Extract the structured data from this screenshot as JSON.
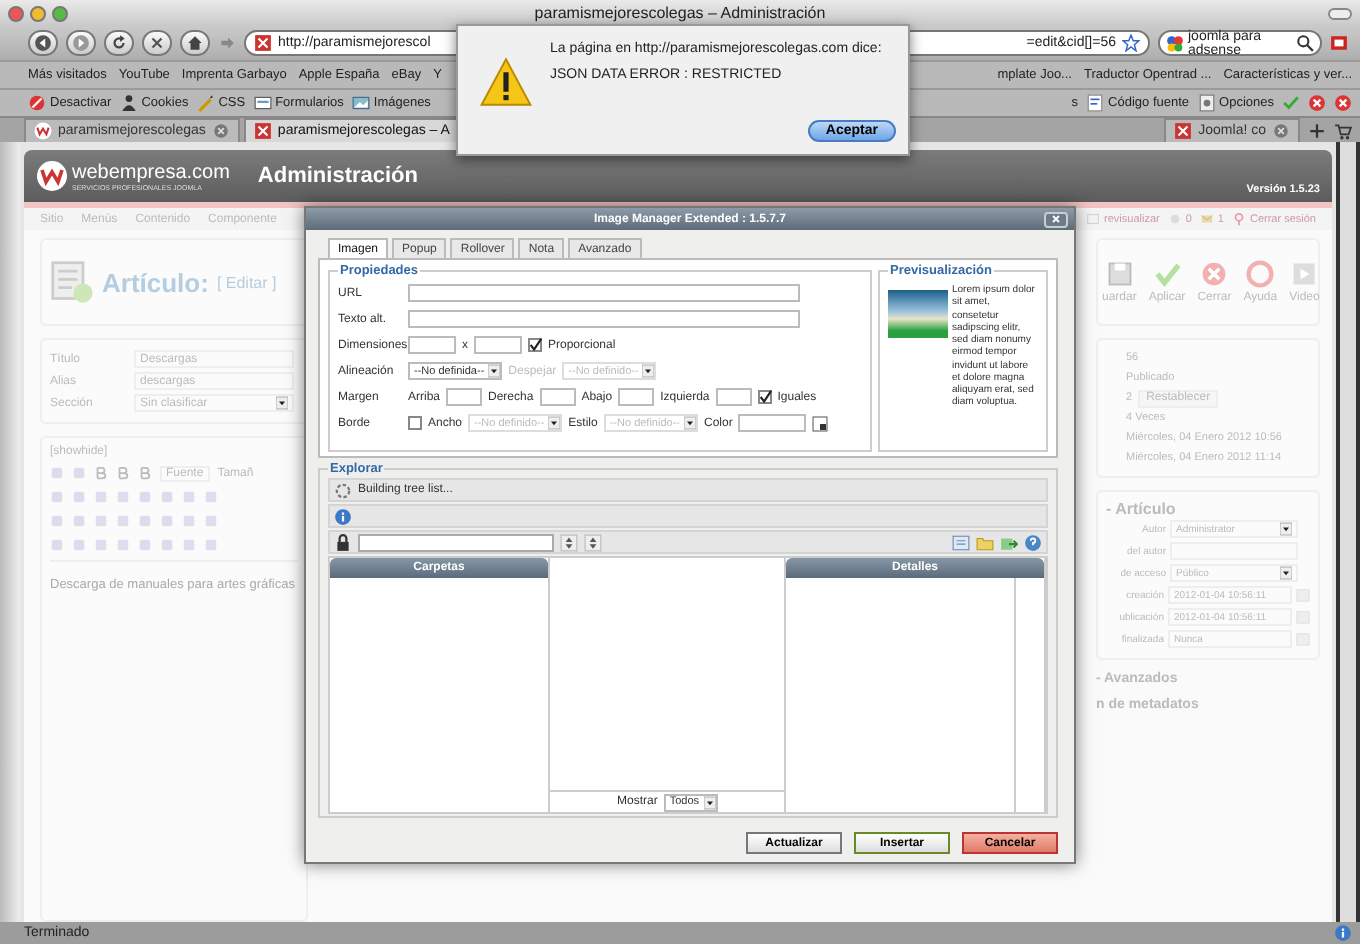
{
  "window": {
    "title": "paramismejorescolegas – Administración"
  },
  "navigation": {
    "url_start": "http://paramismejorescol",
    "url_end": "=edit&cid[]=56",
    "search_value": "joomla para adsense"
  },
  "bookmarks_left": [
    "Más visitados",
    "YouTube",
    "Imprenta Garbayo",
    "Apple España",
    "eBay",
    "Y"
  ],
  "bookmarks_right": [
    "mplate Joo...",
    "Traductor Opentrad ...",
    "Características y ver..."
  ],
  "toolbar_left": [
    {
      "label": "Desactivar",
      "kind": "disable"
    },
    {
      "label": "Cookies",
      "kind": "cookies"
    },
    {
      "label": "CSS",
      "kind": "css"
    },
    {
      "label": "Formularios",
      "kind": "forms"
    },
    {
      "label": "Imágenes",
      "kind": "images"
    }
  ],
  "toolbar_right": [
    {
      "label": "s",
      "kind": "none"
    },
    {
      "label": "Código fuente",
      "kind": "source"
    },
    {
      "label": "Opciones",
      "kind": "options"
    }
  ],
  "tabs": [
    {
      "label": "paramismejorescolegas",
      "selected": false
    },
    {
      "label": "paramismejorescolegas – A",
      "selected": true
    },
    {
      "label": "Joomla! co",
      "selected": false
    }
  ],
  "alert": {
    "message": "La página en http://paramismejorescolegas.com dice:",
    "error": "JSON DATA ERROR : RESTRICTED",
    "button": "Aceptar"
  },
  "site": {
    "logo": "webempresa.com",
    "tagline": "SERVICIOS PROFESIONALES JOOMLA",
    "heading": "Administración",
    "version": "Versión 1.5.23"
  },
  "menu": [
    "Sitio",
    "Menús",
    "Contenido",
    "Componente"
  ],
  "header_links": [
    {
      "label": "revisualizar",
      "kind": "preview"
    },
    {
      "label": "0",
      "kind": "messages"
    },
    {
      "label": "1",
      "kind": "users"
    },
    {
      "label": "Cerrar sesión",
      "kind": "logout"
    }
  ],
  "article": {
    "title": "Artículo:",
    "action": "[ Editar ]"
  },
  "actions": [
    {
      "label": "uardar",
      "kind": "save"
    },
    {
      "label": "Aplicar",
      "kind": "apply"
    },
    {
      "label": "Cerrar",
      "kind": "close"
    },
    {
      "label": "Ayuda",
      "kind": "help"
    },
    {
      "label": "Video",
      "kind": "video"
    }
  ],
  "fields": [
    {
      "label": "Título",
      "value": "Descargas",
      "kind": "text"
    },
    {
      "label": "Alias",
      "value": "descargas",
      "kind": "text"
    },
    {
      "label": "Sección",
      "value": "Sin clasificar",
      "kind": "select"
    }
  ],
  "editor": {
    "tag": "[showhide]",
    "font": "Fuente",
    "size": "Tamañ",
    "content": "Descarga de manuales para artes gráficas"
  },
  "details": [
    {
      "value": "56"
    },
    {
      "value": "Publicado"
    },
    {
      "value": "2",
      "button": "Restablecer"
    },
    {
      "value": "4 Veces"
    },
    {
      "value": "Miércoles, 04 Enero 2012 10:56"
    },
    {
      "value": "Miércoles, 04 Enero 2012 11:14"
    }
  ],
  "parameters": {
    "title": "- Artículo",
    "rows": [
      {
        "label": "Autor",
        "value": "Administrator",
        "kind": "select"
      },
      {
        "label": "del autor",
        "kind": "text"
      },
      {
        "label": "de acceso",
        "value": "Público",
        "kind": "select"
      },
      {
        "label": "creación",
        "value": "2012-01-04 10:56:11",
        "kind": "date"
      },
      {
        "label": "ublicación",
        "value": "2012-01-04 10:56:11",
        "kind": "date"
      },
      {
        "label": "finalizada",
        "value": "Nunca",
        "kind": "date"
      }
    ]
  },
  "sections": [
    "- Avanzados",
    "n de metadatos"
  ],
  "dialog": {
    "title": "Image Manager Extended : 1.5.7.7",
    "tabs": [
      {
        "label": "Imagen",
        "selected": true
      },
      {
        "label": "Popup",
        "selected": false
      },
      {
        "label": "Rollover",
        "selected": false
      },
      {
        "label": "Nota",
        "selected": false
      },
      {
        "label": "Avanzado",
        "selected": false
      }
    ],
    "properties": {
      "legend": "Propiedades",
      "url_label": "URL",
      "alt_label": "Texto alt.",
      "dimensions_label": "Dimensiones",
      "times": "x",
      "proportional": {
        "label": "Proporcional",
        "checked": true
      },
      "align_label": "Alineación",
      "align_value": "--No definida--",
      "clear": {
        "label": "Despejar",
        "disabled": true
      },
      "clear_value": "--No definido--",
      "margin_label": "Margen",
      "margins": [
        "Arriba",
        "Derecha",
        "Abajo",
        "Izquierda"
      ],
      "equal": {
        "label": "Iguales",
        "checked": true
      },
      "border_label": "Borde",
      "border": {
        "label": "Ancho",
        "checked": false
      },
      "width_value": "--No definido--",
      "style_label": "Estilo",
      "style_value": "--No definido--",
      "color_label": "Color"
    },
    "preview": {
      "legend": "Previsualización",
      "text": "Lorem ipsum dolor sit amet, consetetur sadipscing elitr, sed diam nonumy eirmod tempor invidunt ut labore et dolore magna aliquyam erat, sed diam voluptua."
    },
    "explorer": {
      "legend": "Explorar",
      "status": "Building tree list...",
      "folders": "Carpetas",
      "details": "Detalles",
      "show_label": "Mostrar",
      "show_value": "Todos"
    },
    "buttons": [
      {
        "label": "Actualizar",
        "kind": "default"
      },
      {
        "label": "Insertar",
        "kind": "insert"
      },
      {
        "label": "Cancelar",
        "kind": "cancel"
      }
    ]
  },
  "status_bar": "Terminado"
}
